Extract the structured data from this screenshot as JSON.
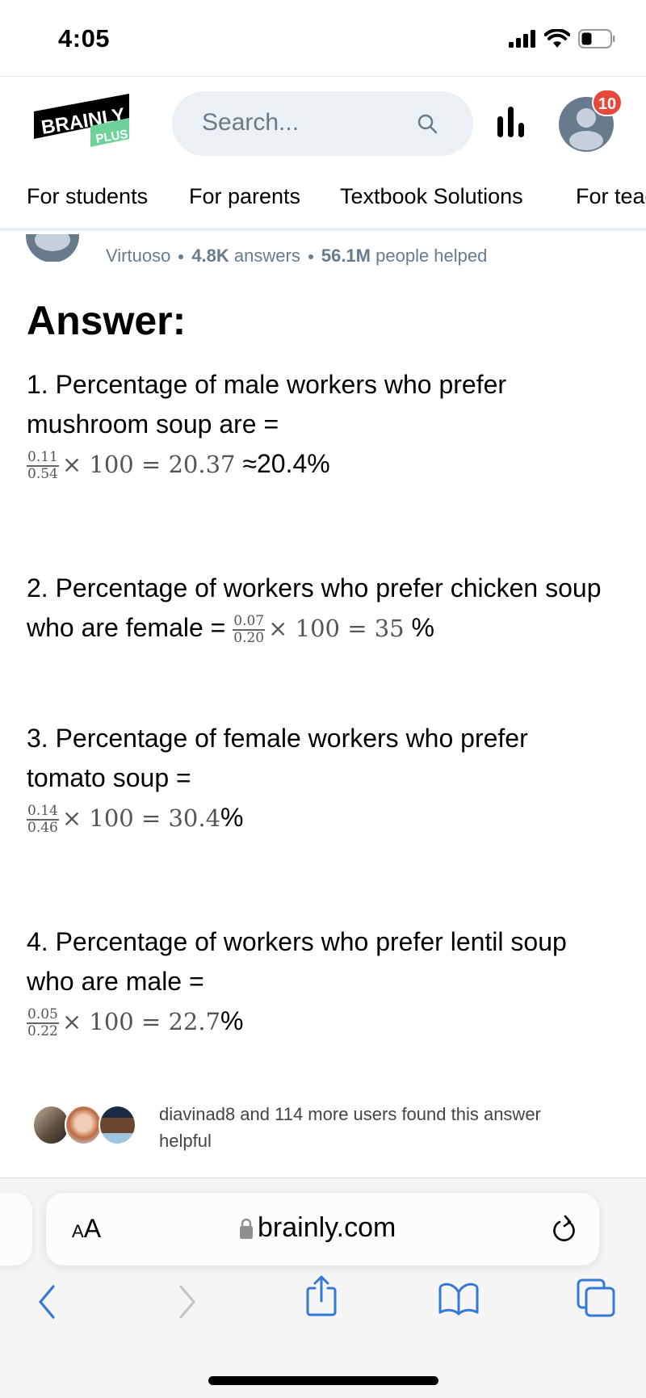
{
  "status_bar": {
    "time": "4:05",
    "icons": [
      "cellular-signal-icon",
      "wifi-icon",
      "battery-icon"
    ]
  },
  "header": {
    "logo_text": "BRAINLY",
    "logo_subtext": "PLUS",
    "search_placeholder": "Search...",
    "notification_count": "10",
    "colors": {
      "brand_green": "#6fd29a",
      "badge_red": "#e8483c",
      "search_bg": "#ebf0f4",
      "avatar_gray": "#687b8c"
    }
  },
  "nav": {
    "tabs": [
      {
        "label": "For students"
      },
      {
        "label": "For parents"
      },
      {
        "label": "Textbook Solutions"
      },
      {
        "label": "For teachers"
      }
    ]
  },
  "author": {
    "rank": "Virtuoso",
    "answers_count": "4.8K",
    "answers_label": "answers",
    "helped_count": "56.1M",
    "helped_label": "people helped"
  },
  "answer": {
    "heading": "Answer:",
    "items": [
      {
        "text": "1. Percentage of male workers who prefer mushroom soup are =",
        "numerator": "0.11",
        "denominator": "0.54",
        "expression": "× 100 = 20.37",
        "suffix": "≈20.4%"
      },
      {
        "text": "2. Percentage of workers who prefer chicken soup who are female =",
        "numerator": "0.07",
        "denominator": "0.20",
        "expression": "× 100 = 35",
        "suffix": "%"
      },
      {
        "text": "3. Percentage of female workers who prefer tomato soup =",
        "numerator": "0.14",
        "denominator": "0.46",
        "expression": "× 100 = 30.4",
        "suffix": "%"
      },
      {
        "text": "4. Percentage of workers who prefer lentil soup who are male =",
        "numerator": "0.05",
        "denominator": "0.22",
        "expression": "× 100 = 22.7",
        "suffix": "%"
      }
    ]
  },
  "helpful": {
    "text": "diavinad8 and 114 more users found this answer helpful"
  },
  "browser": {
    "aa_label_small": "A",
    "aa_label_large": "A",
    "url": "brainly.com",
    "accent_color": "#3478d8"
  }
}
